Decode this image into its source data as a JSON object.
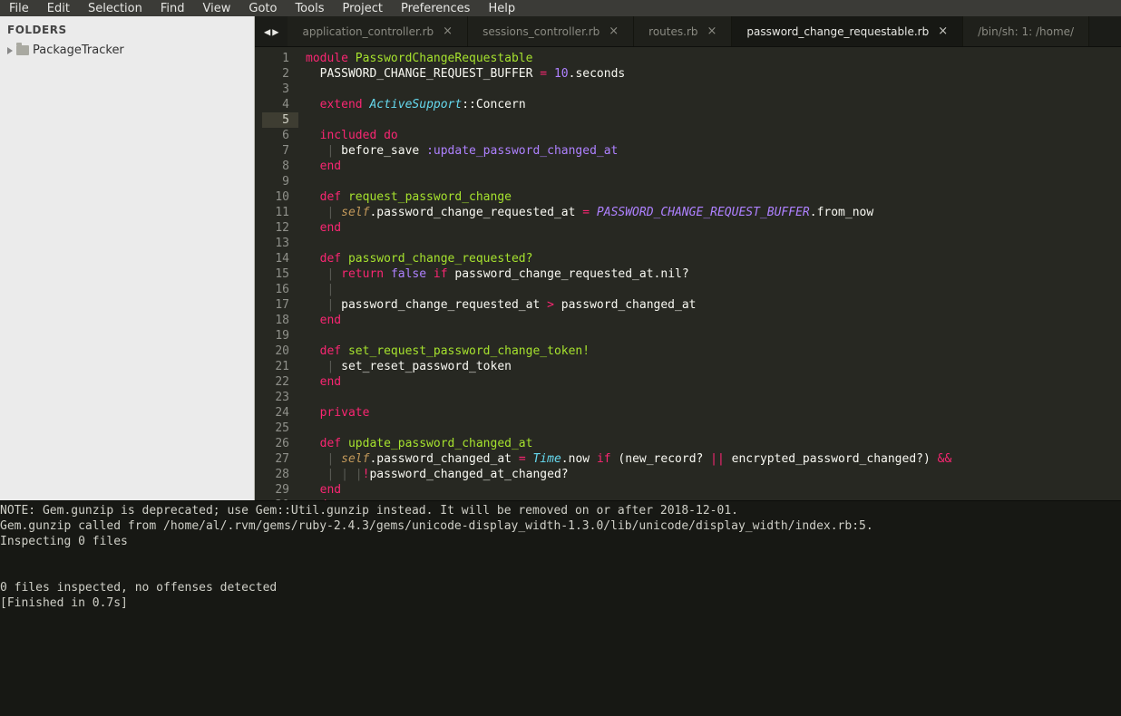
{
  "menu": [
    "File",
    "Edit",
    "Selection",
    "Find",
    "View",
    "Goto",
    "Tools",
    "Project",
    "Preferences",
    "Help"
  ],
  "sidebar": {
    "header": "FOLDERS",
    "root": "PackageTracker"
  },
  "tabs": {
    "arrows": {
      "left": "◀",
      "right": "▶"
    },
    "items": [
      {
        "label": "application_controller.rb",
        "close": "×",
        "active": false
      },
      {
        "label": "sessions_controller.rb",
        "close": "×",
        "active": false
      },
      {
        "label": "routes.rb",
        "close": "×",
        "active": false
      },
      {
        "label": "password_change_requestable.rb",
        "close": "×",
        "active": true
      },
      {
        "label": "/bin/sh: 1: /home/",
        "close": "",
        "active": false
      }
    ]
  },
  "code": {
    "highlight_line": 5,
    "lines": [
      [
        [
          "kw",
          "module"
        ],
        [
          "pun",
          " "
        ],
        [
          "cls",
          "PasswordChangeRequestable"
        ]
      ],
      [
        [
          "pun",
          "  "
        ],
        [
          "id",
          "PASSWORD_CHANGE_REQUEST_BUFFER "
        ],
        [
          "op",
          "="
        ],
        [
          "pun",
          " "
        ],
        [
          "constn",
          "10"
        ],
        [
          "pun",
          "."
        ],
        [
          "id",
          "seconds"
        ]
      ],
      [],
      [
        [
          "pun",
          "  "
        ],
        [
          "kw",
          "extend"
        ],
        [
          "pun",
          " "
        ],
        [
          "type",
          "ActiveSupport"
        ],
        [
          "pun",
          "::"
        ],
        [
          "id",
          "Concern"
        ]
      ],
      [],
      [
        [
          "pun",
          "  "
        ],
        [
          "kw",
          "included"
        ],
        [
          "pun",
          " "
        ],
        [
          "kw",
          "do"
        ]
      ],
      [
        [
          "pun",
          "   "
        ],
        [
          "faint",
          "|"
        ],
        [
          "pun",
          " "
        ],
        [
          "id",
          "before_save "
        ],
        [
          "sym",
          ":update_password_changed_at"
        ]
      ],
      [
        [
          "pun",
          "  "
        ],
        [
          "kw",
          "end"
        ]
      ],
      [],
      [
        [
          "pun",
          "  "
        ],
        [
          "kw",
          "def"
        ],
        [
          "pun",
          " "
        ],
        [
          "fn",
          "request_password_change"
        ]
      ],
      [
        [
          "pun",
          "   "
        ],
        [
          "faint",
          "|"
        ],
        [
          "pun",
          " "
        ],
        [
          "self",
          "self"
        ],
        [
          "pun",
          "."
        ],
        [
          "id",
          "password_change_requested_at "
        ],
        [
          "op",
          "="
        ],
        [
          "pun",
          " "
        ],
        [
          "const",
          "PASSWORD_CHANGE_REQUEST_BUFFER"
        ],
        [
          "pun",
          "."
        ],
        [
          "id",
          "from_now"
        ]
      ],
      [
        [
          "pun",
          "  "
        ],
        [
          "kw",
          "end"
        ]
      ],
      [],
      [
        [
          "pun",
          "  "
        ],
        [
          "kw",
          "def"
        ],
        [
          "pun",
          " "
        ],
        [
          "fn",
          "password_change_requested?"
        ]
      ],
      [
        [
          "pun",
          "   "
        ],
        [
          "faint",
          "|"
        ],
        [
          "pun",
          " "
        ],
        [
          "kw",
          "return"
        ],
        [
          "pun",
          " "
        ],
        [
          "constn",
          "false"
        ],
        [
          "pun",
          " "
        ],
        [
          "kw",
          "if"
        ],
        [
          "pun",
          " "
        ],
        [
          "id",
          "password_change_requested_at"
        ],
        [
          "pun",
          "."
        ],
        [
          "id",
          "nil?"
        ]
      ],
      [
        [
          "pun",
          "   "
        ],
        [
          "faint",
          "|"
        ]
      ],
      [
        [
          "pun",
          "   "
        ],
        [
          "faint",
          "|"
        ],
        [
          "pun",
          " "
        ],
        [
          "id",
          "password_change_requested_at "
        ],
        [
          "op",
          ">"
        ],
        [
          "pun",
          " "
        ],
        [
          "id",
          "password_changed_at"
        ]
      ],
      [
        [
          "pun",
          "  "
        ],
        [
          "kw",
          "end"
        ]
      ],
      [],
      [
        [
          "pun",
          "  "
        ],
        [
          "kw",
          "def"
        ],
        [
          "pun",
          " "
        ],
        [
          "fn",
          "set_request_password_change_token!"
        ]
      ],
      [
        [
          "pun",
          "   "
        ],
        [
          "faint",
          "|"
        ],
        [
          "pun",
          " "
        ],
        [
          "id",
          "set_reset_password_token"
        ]
      ],
      [
        [
          "pun",
          "  "
        ],
        [
          "kw",
          "end"
        ]
      ],
      [],
      [
        [
          "pun",
          "  "
        ],
        [
          "kw",
          "private"
        ]
      ],
      [],
      [
        [
          "pun",
          "  "
        ],
        [
          "kw",
          "def"
        ],
        [
          "pun",
          " "
        ],
        [
          "fn",
          "update_password_changed_at"
        ]
      ],
      [
        [
          "pun",
          "   "
        ],
        [
          "faint",
          "|"
        ],
        [
          "pun",
          " "
        ],
        [
          "self",
          "self"
        ],
        [
          "pun",
          "."
        ],
        [
          "id",
          "password_changed_at "
        ],
        [
          "op",
          "="
        ],
        [
          "pun",
          " "
        ],
        [
          "type",
          "Time"
        ],
        [
          "pun",
          "."
        ],
        [
          "id",
          "now "
        ],
        [
          "kw",
          "if"
        ],
        [
          "pun",
          " ("
        ],
        [
          "id",
          "new_record? "
        ],
        [
          "op",
          "||"
        ],
        [
          "pun",
          " "
        ],
        [
          "id",
          "encrypted_password_changed?"
        ],
        [
          "pun",
          ") "
        ],
        [
          "op",
          "&&"
        ]
      ],
      [
        [
          "pun",
          "   "
        ],
        [
          "faint",
          "|"
        ],
        [
          "pun",
          " "
        ],
        [
          "faint",
          "|"
        ],
        [
          "pun",
          " "
        ],
        [
          "faint",
          "|"
        ],
        [
          "op",
          "!"
        ],
        [
          "id",
          "password_changed_at_changed?"
        ]
      ],
      [
        [
          "pun",
          "  "
        ],
        [
          "kw",
          "end"
        ]
      ],
      [
        [
          "kw",
          "end"
        ]
      ]
    ]
  },
  "console": {
    "lines": [
      "NOTE: Gem.gunzip is deprecated; use Gem::Util.gunzip instead. It will be removed on or after 2018-12-01.",
      "Gem.gunzip called from /home/al/.rvm/gems/ruby-2.4.3/gems/unicode-display_width-1.3.0/lib/unicode/display_width/index.rb:5.",
      "Inspecting 0 files",
      "",
      "",
      "0 files inspected, no offenses detected",
      "[Finished in 0.7s]"
    ]
  }
}
